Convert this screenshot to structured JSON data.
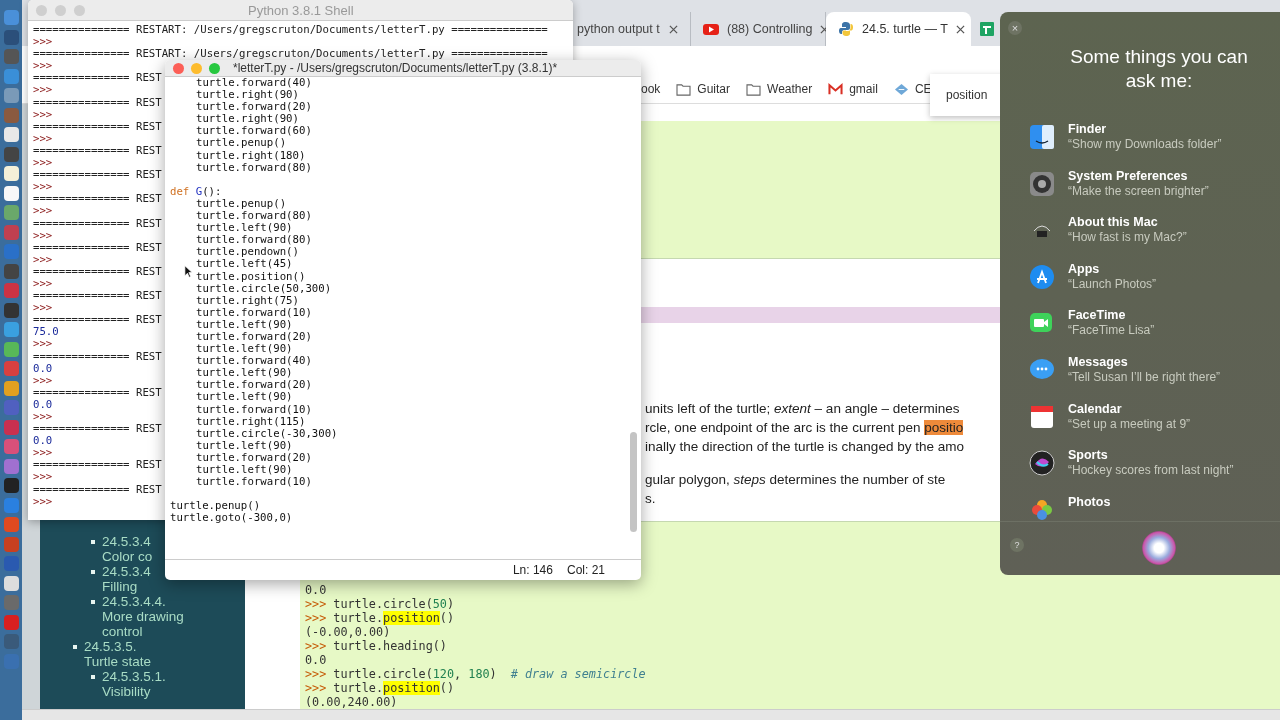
{
  "browser": {
    "tabs": [
      {
        "title": "python output t",
        "kind": "plain",
        "selected": false
      },
      {
        "title": "(88) Controlling",
        "kind": "video",
        "selected": false
      },
      {
        "title": "24.5. turtle — T",
        "kind": "docs",
        "selected": true
      },
      {
        "kind": "sheet",
        "selected": false
      }
    ],
    "bookmarks": [
      {
        "label": "ook",
        "kind": "plain"
      },
      {
        "label": "Guitar",
        "kind": "folder"
      },
      {
        "label": "Weather",
        "kind": "folder"
      },
      {
        "label": "gmail",
        "kind": "mail"
      },
      {
        "label": "CE",
        "kind": "site"
      }
    ],
    "find_popup": {
      "text": "position"
    },
    "sidebar": {
      "items": [
        {
          "kind": "group",
          "children": [
            {
              "number": "24.5.3.4",
              "title": "Color co"
            },
            {
              "number": "24.5.3.4",
              "title": "Filling"
            },
            {
              "number": "24.5.3.4.4.",
              "title": "More drawing control"
            }
          ]
        },
        {
          "number": "24.5.3.5.",
          "title": "Turtle state",
          "children": [
            {
              "number": "24.5.3.5.1.",
              "title": "Visibility"
            }
          ]
        }
      ]
    },
    "paragraphs": [
      [
        [
          {
            "text": "units left of the turtle; ",
            "kind": "plain"
          },
          {
            "text": "extent",
            "kind": "italic"
          },
          {
            "text": " – an angle – determines",
            "kind": "plain"
          }
        ],
        [
          {
            "text": "rcle, one endpoint of the arc is the current pen ",
            "kind": "plain"
          },
          {
            "text": "positio",
            "kind": "highlight"
          }
        ],
        [
          {
            "text": "inally the direction of the turtle is changed by the amo",
            "kind": "plain"
          }
        ]
      ],
      [
        [
          {
            "text": "gular polygon, ",
            "kind": "plain"
          },
          {
            "text": "steps",
            "kind": "italic"
          },
          {
            "text": " determines the number of ste",
            "kind": "plain"
          }
        ],
        [
          {
            "text": "s.",
            "kind": "plain"
          }
        ]
      ]
    ],
    "code_lines": [
      [
        {
          "text": "0.0",
          "kind": "out"
        }
      ],
      [
        {
          "text": ">>>",
          "kind": "prompt"
        },
        {
          "text": "turtle.circle(",
          "kind": "plain"
        },
        {
          "text": "50",
          "kind": "num"
        },
        {
          "text": ")",
          "kind": "plain"
        }
      ],
      [
        {
          "text": ">>>",
          "kind": "prompt"
        },
        {
          "text": "turtle.",
          "kind": "plain"
        },
        {
          "text": "position",
          "kind": "hl"
        },
        {
          "text": "()",
          "kind": "plain"
        }
      ],
      [
        {
          "text": "(-0.00,0.00)",
          "kind": "out"
        }
      ],
      [
        {
          "text": ">>>",
          "kind": "prompt"
        },
        {
          "text": "turtle.heading()",
          "kind": "plain"
        }
      ],
      [
        {
          "text": "0.0",
          "kind": "out"
        }
      ],
      [
        {
          "text": ">>>",
          "kind": "prompt"
        },
        {
          "text": "turtle.circle(",
          "kind": "plain"
        },
        {
          "text": "120",
          "kind": "num"
        },
        {
          "text": ", ",
          "kind": "plain"
        },
        {
          "text": "180",
          "kind": "num"
        },
        {
          "text": ")",
          "kind": "plain"
        },
        {
          "text": "# draw a semicircle",
          "kind": "comment"
        }
      ],
      [
        {
          "text": ">>>",
          "kind": "prompt"
        },
        {
          "text": "turtle.",
          "kind": "plain"
        },
        {
          "text": "position",
          "kind": "hl"
        },
        {
          "text": "()",
          "kind": "plain"
        }
      ],
      [
        {
          "text": "(0.00,240.00)",
          "kind": "out"
        }
      ]
    ]
  },
  "shell": {
    "title": "Python 3.8.1 Shell",
    "lines": [
      {
        "kind": "restart",
        "text": "=============== RESTART: /Users/gregscruton/Documents/letterT.py ==============="
      },
      {
        "kind": "prompt",
        "text": ">>>"
      },
      {
        "kind": "restart",
        "text": "=============== RESTART: /Users/gregscruton/Documents/letterT.py ==============="
      },
      {
        "kind": "prompt",
        "text": ">>>"
      },
      {
        "kind": "restart",
        "text": "=============== REST"
      },
      {
        "kind": "prompt",
        "text": ">>>"
      },
      {
        "kind": "restart",
        "text": "=============== REST"
      },
      {
        "kind": "prompt",
        "text": ">>>"
      },
      {
        "kind": "restart",
        "text": "=============== REST"
      },
      {
        "kind": "prompt",
        "text": ">>>"
      },
      {
        "kind": "restart",
        "text": "=============== REST"
      },
      {
        "kind": "prompt",
        "text": ">>>"
      },
      {
        "kind": "restart",
        "text": "=============== REST"
      },
      {
        "kind": "prompt",
        "text": ">>>"
      },
      {
        "kind": "restart",
        "text": "=============== REST"
      },
      {
        "kind": "prompt",
        "text": ">>>"
      },
      {
        "kind": "restart",
        "text": "=============== REST"
      },
      {
        "kind": "prompt",
        "text": ">>>"
      },
      {
        "kind": "restart",
        "text": "=============== REST"
      },
      {
        "kind": "prompt",
        "text": ">>>"
      },
      {
        "kind": "restart",
        "text": "=============== REST"
      },
      {
        "kind": "prompt",
        "text": ">>>"
      },
      {
        "kind": "restart",
        "text": "=============== REST"
      },
      {
        "kind": "prompt",
        "text": ">>>"
      },
      {
        "kind": "restart",
        "text": "=============== REST"
      },
      {
        "kind": "output",
        "text": "75.0"
      },
      {
        "kind": "prompt",
        "text": ">>>"
      },
      {
        "kind": "restart",
        "text": "=============== REST"
      },
      {
        "kind": "output",
        "text": "0.0"
      },
      {
        "kind": "prompt",
        "text": ">>>"
      },
      {
        "kind": "restart",
        "text": "=============== REST"
      },
      {
        "kind": "output",
        "text": "0.0"
      },
      {
        "kind": "prompt",
        "text": ">>>"
      },
      {
        "kind": "restart",
        "text": "=============== REST"
      },
      {
        "kind": "output",
        "text": "0.0"
      },
      {
        "kind": "prompt",
        "text": ">>>"
      },
      {
        "kind": "restart",
        "text": "=============== REST"
      },
      {
        "kind": "prompt",
        "text": ">>>"
      },
      {
        "kind": "restart",
        "text": "=============== REST"
      },
      {
        "kind": "prompt",
        "text": ">>>"
      }
    ]
  },
  "editor": {
    "title": "*letterT.py - /Users/gregscruton/Documents/letterT.py (3.8.1)*",
    "lines": [
      {
        "kind": "block",
        "children": [
          {
            "kind": "code",
            "text": "turtle.forward(40)"
          },
          {
            "kind": "code",
            "text": "turtle.right(90)"
          },
          {
            "kind": "code",
            "text": "turtle.forward(20)"
          },
          {
            "kind": "code",
            "text": "turtle.right(90)"
          },
          {
            "kind": "code",
            "text": "turtle.forward(60)"
          },
          {
            "kind": "code",
            "text": "turtle.penup()"
          },
          {
            "kind": "code",
            "text": "turtle.right(180)"
          },
          {
            "kind": "code",
            "text": "turtle.forward(80)"
          }
        ]
      },
      {
        "kind": "blank"
      },
      {
        "kind": "def",
        "keyword": "def",
        "name": "G",
        "rest": "():",
        "children": [
          {
            "kind": "code",
            "text": "turtle.penup()"
          },
          {
            "kind": "code",
            "text": "turtle.forward(80)"
          },
          {
            "kind": "code",
            "text": "turtle.left(90)"
          },
          {
            "kind": "code",
            "text": "turtle.forward(80)"
          },
          {
            "kind": "code",
            "text": "turtle.pendown()"
          },
          {
            "kind": "code",
            "text": "turtle.left(45)"
          },
          {
            "kind": "code",
            "text": "turtle.position()"
          },
          {
            "kind": "code",
            "text": "turtle.circle(50,300)"
          },
          {
            "kind": "code",
            "text": "turtle.right(75)"
          },
          {
            "kind": "code",
            "text": "turtle.forward(10)"
          },
          {
            "kind": "code",
            "text": "turtle.left(90)"
          },
          {
            "kind": "code",
            "text": "turtle.forward(20)"
          },
          {
            "kind": "code",
            "text": "turtle.left(90)"
          },
          {
            "kind": "code",
            "text": "turtle.forward(40)"
          },
          {
            "kind": "code",
            "text": "turtle.left(90)"
          },
          {
            "kind": "code",
            "text": "turtle.forward(20)"
          },
          {
            "kind": "code",
            "text": "turtle.left(90)"
          },
          {
            "kind": "code",
            "text": "turtle.forward(10)"
          },
          {
            "kind": "code",
            "text": "turtle.right(115)"
          },
          {
            "kind": "code",
            "text": "turtle.circle(-30,300)"
          },
          {
            "kind": "code",
            "text": "turtle.left(90)"
          },
          {
            "kind": "code",
            "text": "turtle.forward(20)"
          },
          {
            "kind": "code",
            "text": "turtle.left(90)"
          },
          {
            "kind": "code",
            "text": "turtle.forward(10)"
          }
        ]
      },
      {
        "kind": "blank"
      },
      {
        "kind": "code",
        "text": "turtle.penup()"
      },
      {
        "kind": "code",
        "text": "turtle.goto(-300,0)"
      }
    ],
    "status": {
      "line": "Ln: 146",
      "column": "Col: 21"
    }
  },
  "siri": {
    "close": "×",
    "heading": "Some things you can ask me:",
    "help": "?",
    "suggestions": [
      {
        "kind": "finder",
        "app": "Finder",
        "example": "“Show my Downloads folder”"
      },
      {
        "kind": "gear",
        "app": "System Preferences",
        "example": "“Make the screen brighter”"
      },
      {
        "kind": "chip",
        "app": "About this Mac",
        "example": "“How fast is my Mac?”"
      },
      {
        "kind": "apps",
        "app": "Apps",
        "example": "“Launch Photos”"
      },
      {
        "kind": "facetime",
        "app": "FaceTime",
        "example": "“FaceTime Lisa”"
      },
      {
        "kind": "messages",
        "app": "Messages",
        "example": "“Tell Susan I’ll be right there”"
      },
      {
        "kind": "calendar",
        "app": "Calendar",
        "example": "“Set up a meeting at 9”"
      },
      {
        "kind": "sports",
        "app": "Sports",
        "example": "“Hockey scores from last night”"
      },
      {
        "kind": "photos",
        "app": "Photos"
      }
    ]
  }
}
